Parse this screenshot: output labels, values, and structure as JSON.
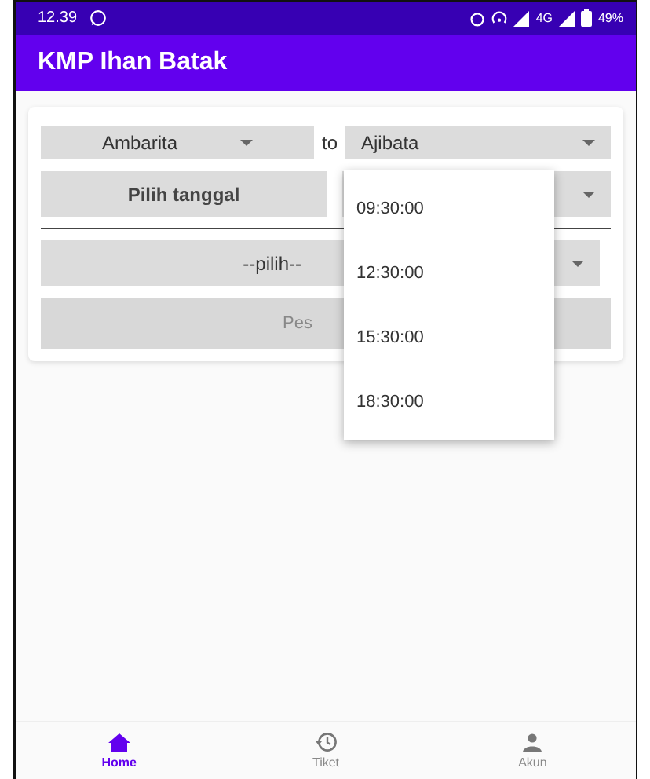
{
  "status_bar": {
    "time": "12.39",
    "battery": "49%",
    "network": "4G"
  },
  "app_bar": {
    "title": "KMP Ihan Batak"
  },
  "form": {
    "origin": {
      "value": "Ambarita"
    },
    "connector": "to",
    "destination": {
      "value": "Ajibata"
    },
    "date_button": "Pilih tanggal",
    "time_spinner": {
      "expanded": true,
      "options": [
        {
          "label": "09:30:00"
        },
        {
          "label": "12:30:00"
        },
        {
          "label": "15:30:00"
        },
        {
          "label": "18:30:00"
        }
      ]
    },
    "class_spinner": {
      "value": "--pilih--"
    },
    "submit_button": "Pes"
  },
  "bottom_nav": [
    {
      "label": "Home",
      "kind": "home",
      "selected": true
    },
    {
      "label": "Tiket",
      "kind": "history",
      "selected": false
    },
    {
      "label": "Akun",
      "kind": "person",
      "selected": false
    }
  ]
}
